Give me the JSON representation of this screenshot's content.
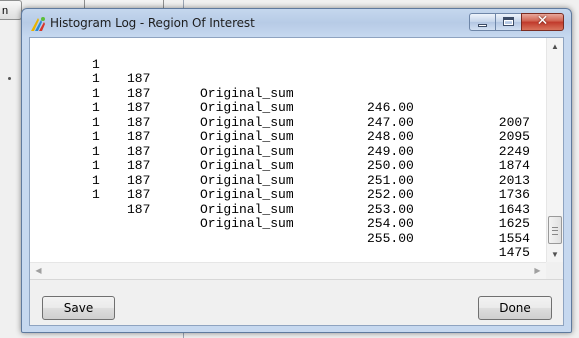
{
  "background_window": {
    "button_label": "n"
  },
  "window": {
    "title": "Histogram Log - Region Of Interest",
    "caption_buttons": {
      "minimize_icon": "minimize-icon",
      "maximize_icon": "maximize-icon",
      "close_icon": "close-icon",
      "close_glyph": "✕"
    }
  },
  "log": {
    "rows": [
      [
        "1",
        "187",
        "Original_sum",
        "246.00",
        "2007"
      ],
      [
        "1",
        "187",
        "Original_sum",
        "247.00",
        "2095"
      ],
      [
        "1",
        "187",
        "Original_sum",
        "248.00",
        "2249"
      ],
      [
        "1",
        "187",
        "Original_sum",
        "249.00",
        "1874"
      ],
      [
        "1",
        "187",
        "Original_sum",
        "250.00",
        "2013"
      ],
      [
        "1",
        "187",
        "Original_sum",
        "251.00",
        "1736"
      ],
      [
        "1",
        "187",
        "Original_sum",
        "252.00",
        "1643"
      ],
      [
        "1",
        "187",
        "Original_sum",
        "253.00",
        "1625"
      ],
      [
        "1",
        "187",
        "Original_sum",
        "254.00",
        "1554"
      ],
      [
        "1",
        "187",
        "Original_sum",
        "255.00",
        "1475"
      ]
    ]
  },
  "buttons": {
    "save": "Save",
    "done": "Done"
  },
  "colors": {
    "titlebar": "#c5d7ee",
    "close_button": "#c0392b"
  }
}
